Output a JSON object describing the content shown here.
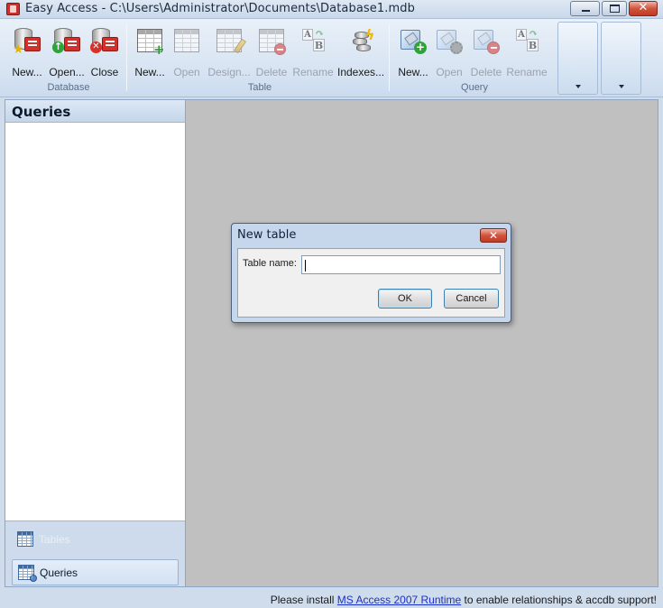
{
  "window": {
    "title": "Easy Access - C:\\Users\\Administrator\\Documents\\Database1.mdb",
    "close_glyph": "✕"
  },
  "ribbon": {
    "groups": {
      "database": "Database",
      "table": "Table",
      "query": "Query"
    },
    "database": {
      "new": "New...",
      "open": "Open...",
      "close": "Close"
    },
    "table": {
      "new": "New...",
      "open": "Open",
      "design": "Design...",
      "delete": "Delete",
      "rename": "Rename",
      "indexes": "Indexes..."
    },
    "query": {
      "new": "New...",
      "open": "Open",
      "delete": "Delete",
      "rename": "Rename"
    }
  },
  "nav": {
    "header": "Queries",
    "tables_label": "Tables",
    "queries_label": "Queries"
  },
  "dialog": {
    "title": "New table",
    "close_glyph": "✕",
    "label": "Table name:",
    "input_value": "",
    "ok": "OK",
    "cancel": "Cancel"
  },
  "status": {
    "prefix": "Please install ",
    "link": "MS Access 2007 Runtime",
    "suffix": " to enable relationships & accdb support!"
  },
  "colors": {
    "accent": "#cfdcec",
    "workspace": "#c0c0c0",
    "link": "#1b31c9"
  }
}
